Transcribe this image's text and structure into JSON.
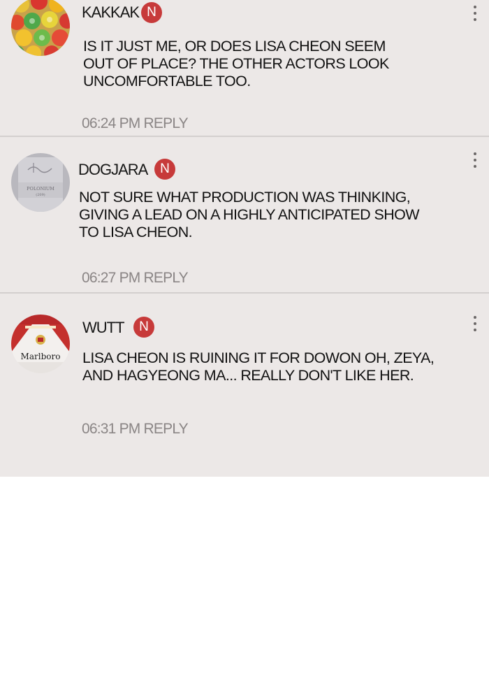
{
  "comments": [
    {
      "username": "KAKKAK",
      "badge": "N",
      "avatar_icon": "colorful-candy-avatar-icon",
      "text_lines": [
        "IS IT JUST ME, OR DOES LISA CHEON SEEM",
        "OUT OF PLACE? THE OTHER ACTORS LOOK",
        "UNCOMFORTABLE TOO."
      ],
      "time": "06:24 PM",
      "reply_label": "REPLY"
    },
    {
      "username": "DOGJARA",
      "badge": "N",
      "avatar_icon": "polonium-bottle-avatar-icon",
      "avatar_label": "POLONIUM",
      "avatar_sublabel": "(209)",
      "text_lines": [
        "NOT SURE WHAT PRODUCTION WAS THINKING,",
        "GIVING A LEAD ON A HIGHLY ANTICIPATED SHOW",
        "TO LISA CHEON."
      ],
      "time": "06:27 PM",
      "reply_label": "REPLY"
    },
    {
      "username": "WUTT",
      "badge": "N",
      "avatar_icon": "cigarette-pack-avatar-icon",
      "avatar_label": "Marlboro",
      "text_lines": [
        "LISA CHEON IS RUINING IT FOR DOWON OH, ZEYA,",
        "AND HAGYEONG MA... REALLY DON'T LIKE HER."
      ],
      "time": "06:31 PM",
      "reply_label": "REPLY"
    }
  ],
  "colors": {
    "panel_bg": "#ece8e7",
    "badge_red": "#c73a3a",
    "meta_gray": "#8a8585",
    "divider": "#d3cfce"
  }
}
